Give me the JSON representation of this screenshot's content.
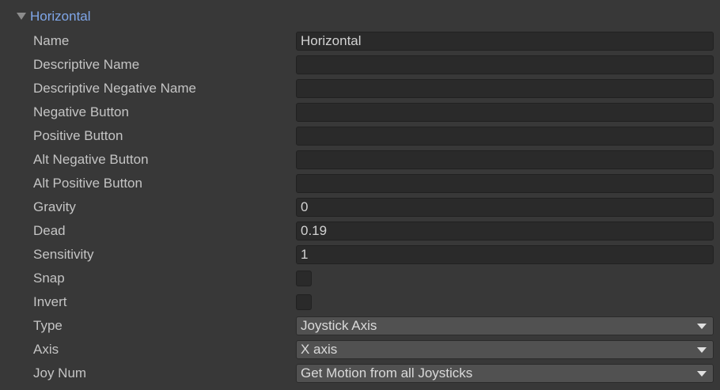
{
  "foldout": {
    "title": "Horizontal",
    "expanded": true,
    "icon": "triangle-down-icon"
  },
  "fields": {
    "name": {
      "label": "Name",
      "value": "Horizontal"
    },
    "descriptive_name": {
      "label": "Descriptive Name",
      "value": ""
    },
    "descriptive_negative_name": {
      "label": "Descriptive Negative Name",
      "value": ""
    },
    "negative_button": {
      "label": "Negative Button",
      "value": ""
    },
    "positive_button": {
      "label": "Positive Button",
      "value": ""
    },
    "alt_negative_button": {
      "label": "Alt Negative Button",
      "value": ""
    },
    "alt_positive_button": {
      "label": "Alt Positive Button",
      "value": ""
    },
    "gravity": {
      "label": "Gravity",
      "value": "0"
    },
    "dead": {
      "label": "Dead",
      "value": "0.19"
    },
    "sensitivity": {
      "label": "Sensitivity",
      "value": "1"
    },
    "snap": {
      "label": "Snap",
      "checked": false
    },
    "invert": {
      "label": "Invert",
      "checked": false
    },
    "type": {
      "label": "Type",
      "value": "Joystick Axis"
    },
    "axis": {
      "label": "Axis",
      "value": "X axis"
    },
    "joy_num": {
      "label": "Joy Num",
      "value": "Get Motion from all Joysticks"
    }
  },
  "colors": {
    "background": "#383838",
    "field_bg": "#2a2a2a",
    "dropdown_bg": "#515151",
    "foldout_title": "#7fa6e8",
    "label": "#c4c4c4"
  }
}
